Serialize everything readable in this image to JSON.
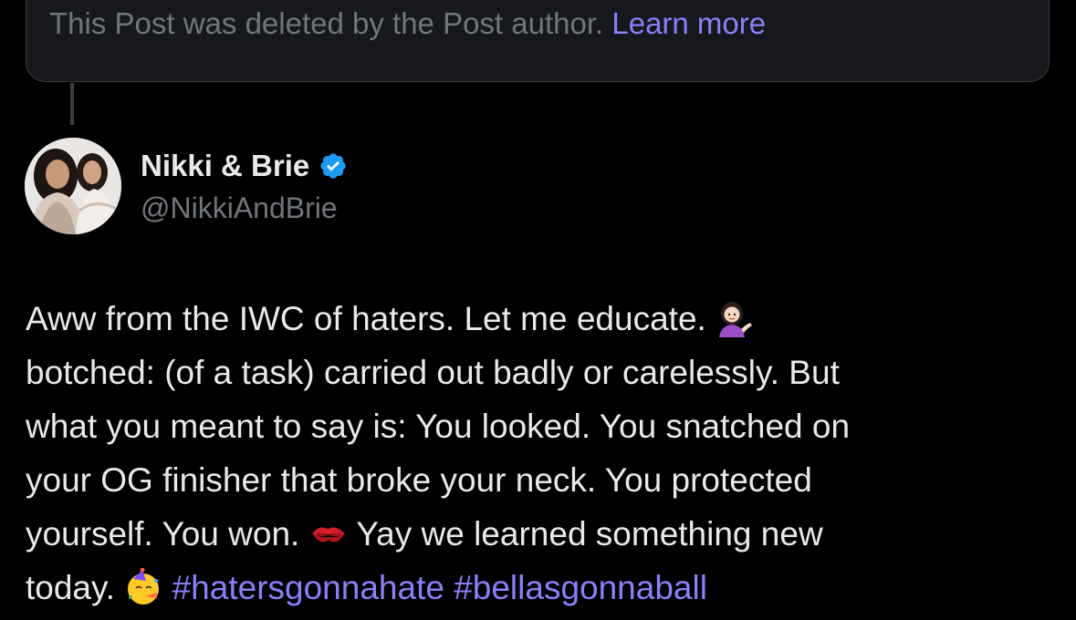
{
  "deleted_notice": {
    "text": "This Post was deleted by the Post author. ",
    "link": "Learn more"
  },
  "author": {
    "display_name": "Nikki & Brie",
    "handle": "@NikkiAndBrie",
    "verified": true
  },
  "post": {
    "lines": [
      "Aww from the IWC of haters. Let me educate. ",
      "botched: (of a task) carried out badly or carelessly. But",
      "what you meant to say is: You looked. You snatched on",
      "your OG finisher that broke your neck. You protected",
      "yourself. You won. ",
      " Yay we learned something new",
      "today. "
    ],
    "hashtags": [
      "#hatersgonnahate",
      "#bellasgonnaball"
    ],
    "emojis": [
      "person-tipping-hand-emoji",
      "kiss-mark-emoji",
      "partying-face-emoji"
    ]
  },
  "colors": {
    "background": "#000000",
    "text": "#e7e9ea",
    "secondary_text": "#71767b",
    "link": "#8b80f9",
    "verified_badge": "#1d9bf0",
    "card_border": "#3a3d41"
  }
}
